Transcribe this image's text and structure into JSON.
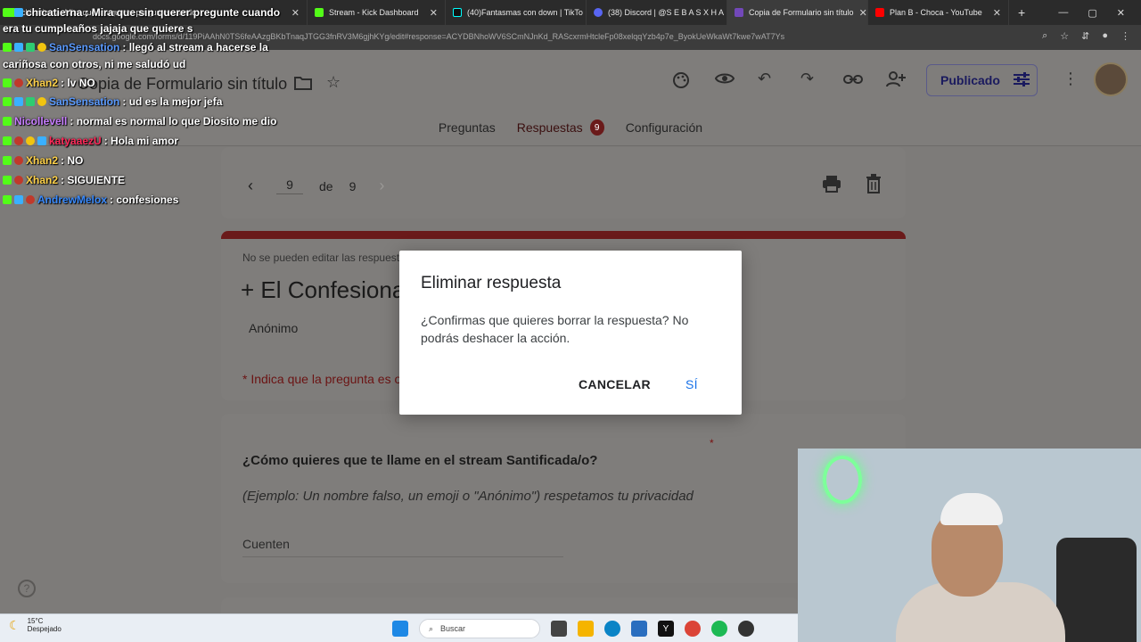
{
  "browser": {
    "tabs": [
      {
        "label": "chicatierna: Mira que sin querer pregunte cuando",
        "color": "#53fc18"
      },
      {
        "label": "Stream - Kick Dashboard",
        "color": "#53fc18"
      },
      {
        "label": "(40)Fantasmas con down | TikTo",
        "color": "#111111"
      },
      {
        "label": "(38) Discord | @S E B A S X H A",
        "color": "#5865f2"
      },
      {
        "label": "Copia de Formulario sin título",
        "color": "#7248b9"
      },
      {
        "label": "Plan B - Choca - YouTube",
        "color": "#ff0000"
      }
    ],
    "active_tab": 4,
    "new_tab": "+",
    "url": "docs.google.com/forms/d/119PiAAhN0TS6feAAzgBKbTnaqJTGG3fnRV3M6gjhKYg/edit#response=ACYDBNhoWV6SCmNJnKd_RAScxrmHtcleFp08xelqqYzb4p7e_ByokUeWkaWt7kwe7wAT7Ys",
    "window_controls": [
      "—",
      "▢",
      "✕"
    ],
    "addr_icons": [
      "⌕",
      "☆",
      "⇵",
      "●",
      "⋮"
    ]
  },
  "forms": {
    "doc_title": "Copia de Formulario sin título",
    "publish_label": "Publicado",
    "tabs": [
      {
        "label": "Preguntas"
      },
      {
        "label": "Respuestas",
        "badge": "9"
      },
      {
        "label": "Configuración"
      }
    ],
    "nav": {
      "current": "9",
      "of": "de",
      "total": "9"
    },
    "notice": "No se pueden editar las respuestas",
    "form_title": "+  El Confesionario",
    "anon": "Anónimo",
    "required_note": "* Indica que la pregunta es obligatoria",
    "question": {
      "title": "¿Cómo quieres que te llame en el stream Santificada/o?",
      "star": "*",
      "help": "(Ejemplo: Un nombre falso, un emoji o \"Anónimo\") respetamos tu privacidad",
      "answer": "Cuenten"
    },
    "help_icon": "?"
  },
  "dialog": {
    "title": "Eliminar respuesta",
    "body": "¿Confirmas que quieres borrar la respuesta? No podrás deshacer la acción.",
    "cancel": "CANCELAR",
    "confirm": "SÍ"
  },
  "chat": [
    {
      "user": "chicatierna",
      "msg": ": Mira que sin querer pregunte cuando",
      "color": "#ffffff"
    },
    {
      "user": "",
      "msg": "era tu cumpleaños jajaja que quiere s",
      "color": "#ffffff"
    },
    {
      "user": "SanSensation",
      "msg": ": llegó al stream a hacerse la",
      "color": "#5b9bff"
    },
    {
      "user": "",
      "msg": "cariñosa con otros, ni me saludó ud",
      "color": "#ffffff"
    },
    {
      "user": "Xhan2",
      "msg": ": lv NO",
      "color": "#ffd24a"
    },
    {
      "user": "SanSensation",
      "msg": ": ud es la mejor jefa",
      "color": "#5b9bff"
    },
    {
      "user": "Nicollevell",
      "msg": ": normal es normal lo que Diosito me dio",
      "color": "#c77dff"
    },
    {
      "user": "katyaaezU",
      "msg": ": Hola mi amor",
      "color": "#ff2a5a"
    },
    {
      "user": "Xhan2",
      "msg": ": NO",
      "color": "#ffd24a"
    },
    {
      "user": "Xhan2",
      "msg": ": SIGUIENTE",
      "color": "#ffd24a"
    },
    {
      "user": "AndrewMelox",
      "msg": ": confesiones",
      "color": "#3a8bff"
    }
  ],
  "taskbar": {
    "temp": "15°C",
    "weather": "Despejado",
    "search_placeholder": "Buscar"
  }
}
